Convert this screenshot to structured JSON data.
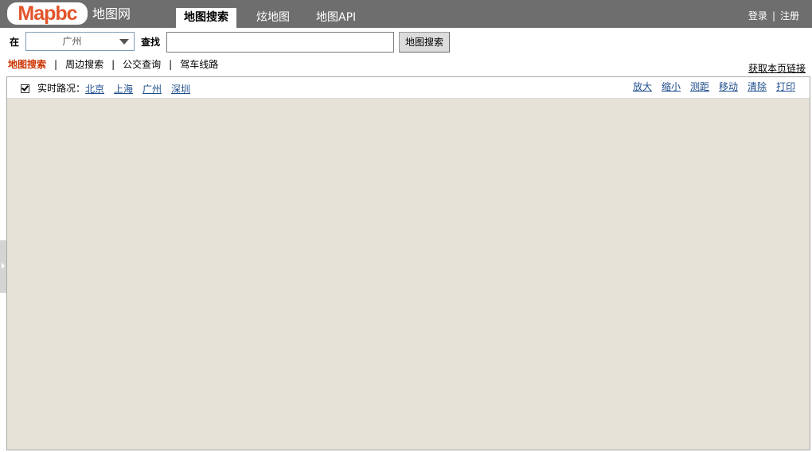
{
  "header": {
    "logo_text": "Mapbc",
    "site_name": "地图网",
    "tabs": [
      {
        "label": "地图搜索",
        "active": true
      },
      {
        "label": "炫地图",
        "active": false
      },
      {
        "label": "地图API",
        "active": false
      }
    ],
    "login": "登录",
    "separator": "|",
    "register": "注册"
  },
  "search": {
    "in_label": "在",
    "city_value": "广州",
    "find_label": "查找",
    "query_value": "",
    "button_label": "地图搜索"
  },
  "subnav": {
    "items": [
      {
        "label": "地图搜索",
        "active": true
      },
      {
        "label": "周边搜索",
        "active": false
      },
      {
        "label": "公交查询",
        "active": false
      },
      {
        "label": "驾车线路",
        "active": false
      }
    ],
    "separator": "|",
    "get_link": "获取本页链接"
  },
  "map": {
    "traffic_checked": true,
    "traffic_label": "实时路况：",
    "cities": [
      "北京",
      "上海",
      "广州",
      "深圳"
    ],
    "tools": [
      "放大",
      "缩小",
      "测距",
      "移动",
      "清除",
      "打印"
    ],
    "background_color": "#e6e2d8"
  }
}
